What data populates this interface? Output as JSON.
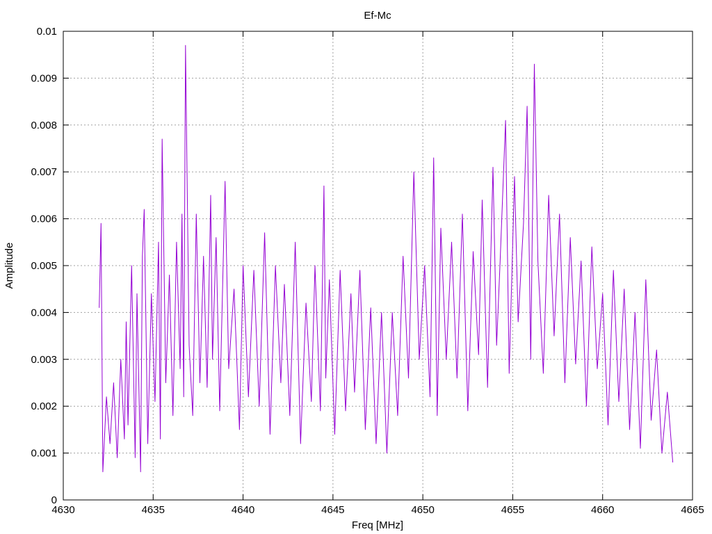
{
  "chart_data": {
    "type": "line",
    "title": "Ef-Mc",
    "xlabel": "Freq [MHz]",
    "ylabel": "Amplitude",
    "xlim": [
      4630,
      4665
    ],
    "ylim": [
      0,
      0.01
    ],
    "xticks": [
      "4630",
      "4635",
      "4640",
      "4645",
      "4650",
      "4655",
      "4660",
      "4665"
    ],
    "yticks": [
      "0",
      "0.001",
      "0.002",
      "0.003",
      "0.004",
      "0.005",
      "0.006",
      "0.007",
      "0.008",
      "0.009",
      "0.01"
    ],
    "grid": true,
    "legend": "none",
    "series_color": "#9400d3",
    "series": [
      {
        "x": [
          4632.0,
          4632.1,
          4632.2,
          4632.4,
          4632.6,
          4632.8,
          4633.0,
          4633.2,
          4633.4,
          4633.5,
          4633.6,
          4633.8,
          4634.0,
          4634.1,
          4634.3,
          4634.4,
          4634.5,
          4634.7,
          4634.9,
          4635.1,
          4635.3,
          4635.4,
          4635.5,
          4635.7,
          4635.9,
          4636.1,
          4636.3,
          4636.5,
          4636.6,
          4636.7,
          4636.8,
          4637.0,
          4637.2,
          4637.4,
          4637.6,
          4637.8,
          4638.0,
          4638.2,
          4638.3,
          4638.5,
          4638.7,
          4639.0,
          4639.2,
          4639.5,
          4639.8,
          4640.0,
          4640.3,
          4640.6,
          4640.9,
          4641.2,
          4641.5,
          4641.8,
          4642.1,
          4642.3,
          4642.6,
          4642.9,
          4643.2,
          4643.5,
          4643.8,
          4644.0,
          4644.3,
          4644.5,
          4644.6,
          4644.8,
          4645.1,
          4645.4,
          4645.7,
          4646.0,
          4646.2,
          4646.5,
          4646.8,
          4647.1,
          4647.4,
          4647.7,
          4648.0,
          4648.3,
          4648.6,
          4648.9,
          4649.2,
          4649.5,
          4649.8,
          4650.1,
          4650.4,
          4650.6,
          4650.8,
          4651.0,
          4651.3,
          4651.6,
          4651.9,
          4652.2,
          4652.5,
          4652.8,
          4653.1,
          4653.3,
          4653.6,
          4653.9,
          4654.1,
          4654.3,
          4654.6,
          4654.8,
          4655.1,
          4655.3,
          4655.6,
          4655.8,
          4656.0,
          4656.2,
          4656.4,
          4656.7,
          4657.0,
          4657.3,
          4657.6,
          4657.9,
          4658.2,
          4658.5,
          4658.8,
          4659.1,
          4659.4,
          4659.7,
          4660.0,
          4660.3,
          4660.6,
          4660.9,
          4661.2,
          4661.5,
          4661.8,
          4662.1,
          4662.4,
          4662.7,
          4663.0,
          4663.3,
          4663.6,
          4663.9
        ],
        "values": [
          0.0041,
          0.0059,
          0.0006,
          0.0022,
          0.0012,
          0.0025,
          0.0009,
          0.003,
          0.0013,
          0.0038,
          0.0016,
          0.005,
          0.0009,
          0.0044,
          0.0006,
          0.0052,
          0.0062,
          0.0012,
          0.0044,
          0.0021,
          0.0055,
          0.0013,
          0.0077,
          0.0025,
          0.0048,
          0.0018,
          0.0055,
          0.0028,
          0.0061,
          0.0022,
          0.0097,
          0.0033,
          0.0018,
          0.0061,
          0.0025,
          0.0052,
          0.0024,
          0.0065,
          0.003,
          0.0056,
          0.0019,
          0.0068,
          0.0028,
          0.0045,
          0.0015,
          0.005,
          0.0022,
          0.0049,
          0.002,
          0.0057,
          0.0014,
          0.005,
          0.0025,
          0.0046,
          0.0018,
          0.0055,
          0.0012,
          0.0042,
          0.0021,
          0.005,
          0.0019,
          0.0067,
          0.0026,
          0.0047,
          0.0014,
          0.0049,
          0.0019,
          0.0044,
          0.0023,
          0.0049,
          0.0015,
          0.0041,
          0.0012,
          0.004,
          0.001,
          0.004,
          0.0018,
          0.0052,
          0.0026,
          0.007,
          0.003,
          0.005,
          0.0022,
          0.0073,
          0.0018,
          0.0058,
          0.003,
          0.0055,
          0.0026,
          0.0061,
          0.0019,
          0.0053,
          0.0031,
          0.0064,
          0.0024,
          0.0071,
          0.0033,
          0.0051,
          0.0081,
          0.0027,
          0.0069,
          0.0038,
          0.0059,
          0.0084,
          0.003,
          0.0093,
          0.0051,
          0.0027,
          0.0065,
          0.0035,
          0.0061,
          0.0025,
          0.0056,
          0.0029,
          0.0051,
          0.002,
          0.0054,
          0.0028,
          0.0044,
          0.0016,
          0.0049,
          0.0021,
          0.0045,
          0.0015,
          0.004,
          0.0011,
          0.0047,
          0.0017,
          0.0032,
          0.001,
          0.0023,
          0.0008
        ]
      }
    ]
  }
}
